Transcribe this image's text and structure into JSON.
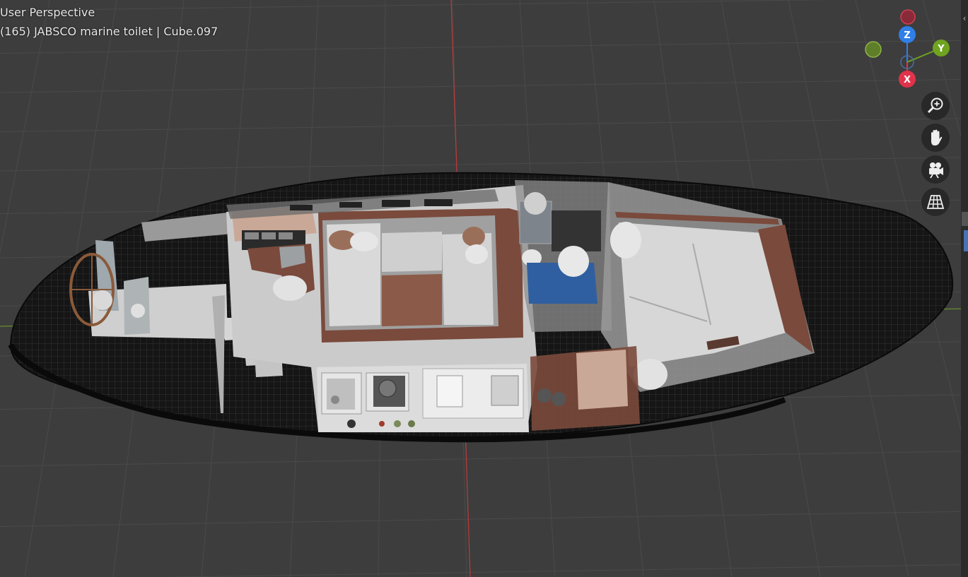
{
  "viewport": {
    "view_name": "User Perspective",
    "object_info": "(165) JABSCO marine toilet | Cube.097"
  },
  "gizmo": {
    "axes": [
      {
        "label": "Z",
        "color": "#2f7fe6"
      },
      {
        "label": "Y",
        "color": "#6fa320"
      },
      {
        "label": "X",
        "color": "#e0334b"
      }
    ],
    "negative_colors": {
      "z": "#8a2a38",
      "y": "#5f7e2a",
      "x": "#4b6fa3"
    }
  },
  "nav_tools": [
    {
      "name": "zoom",
      "icon": "magnifier-plus-icon"
    },
    {
      "name": "pan",
      "icon": "hand-icon"
    },
    {
      "name": "camera",
      "icon": "camera-icon"
    },
    {
      "name": "projection",
      "icon": "grid-perspective-icon"
    }
  ],
  "colors": {
    "background": "#3d3d3d",
    "grid_line": "#4a4a4a",
    "x_axis_line": "#c03a3a",
    "y_axis_line": "#6a8f2c",
    "hull_mesh": "#141414",
    "wood": "#7a4a3c",
    "cushion": "#c9c9c9",
    "blue_tank": "#2f5fa0"
  }
}
